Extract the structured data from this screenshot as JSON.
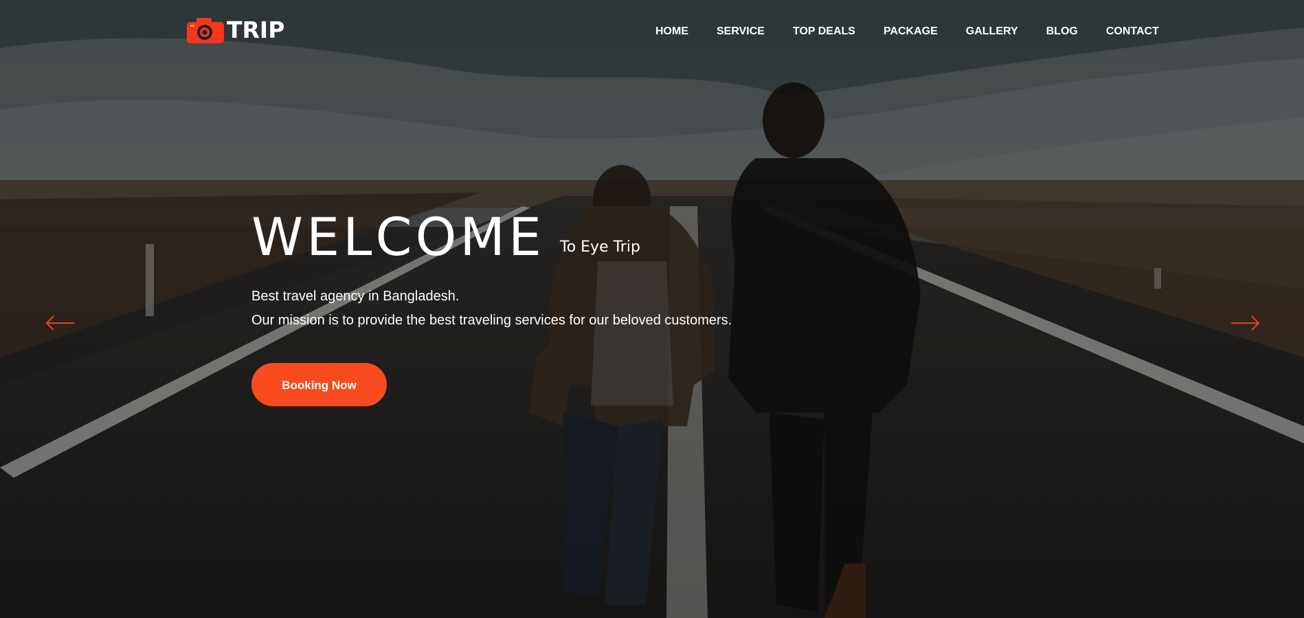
{
  "brand": {
    "name": "TRIP",
    "icon": "camera-icon",
    "color": "#f5371d"
  },
  "nav": {
    "items": [
      {
        "label": "HOME"
      },
      {
        "label": "SERVICE"
      },
      {
        "label": "TOP DEALS"
      },
      {
        "label": "PACKAGE"
      },
      {
        "label": "GALLERY"
      },
      {
        "label": "BLOG"
      },
      {
        "label": "CONTACT"
      }
    ]
  },
  "hero": {
    "title": "WELCOME",
    "subtitle": "To Eye Trip",
    "description_line1": "Best travel agency in Bangladesh.",
    "description_line2": "Our mission is to provide the best traveling services for our beloved customers.",
    "cta_label": "Booking Now",
    "accent_color": "#f84b1f"
  },
  "slider": {
    "prev_icon": "arrow-left-icon",
    "next_icon": "arrow-right-icon"
  }
}
